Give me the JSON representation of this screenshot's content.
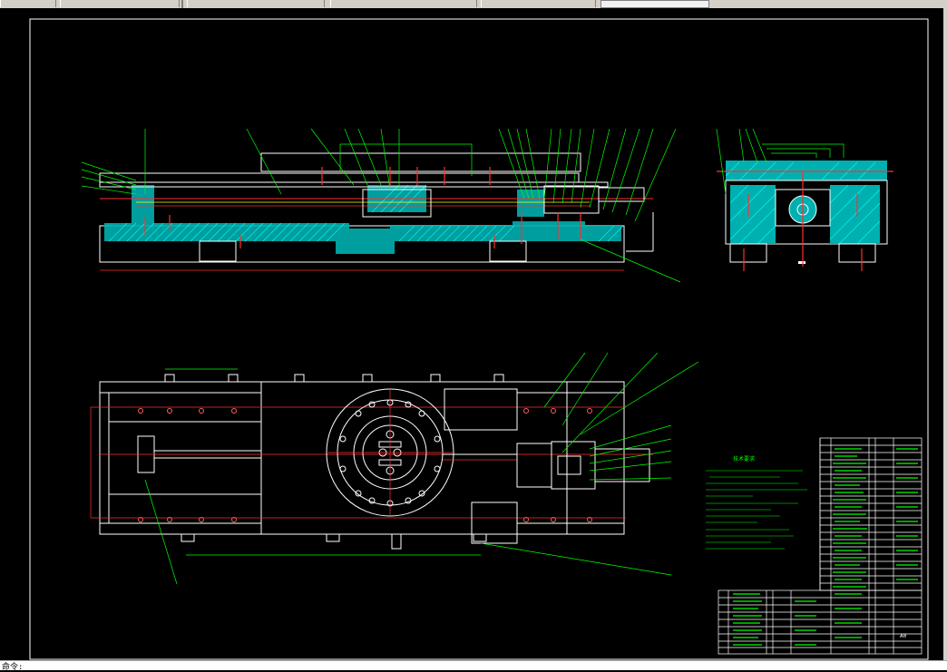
{
  "window": {
    "type": "cad-viewer"
  },
  "toolbar": {
    "tabs": [
      "",
      "",
      "",
      "",
      ""
    ]
  },
  "command_line": {
    "text": "命令:"
  },
  "drawing": {
    "notes_title": "技术要求",
    "title_block": {
      "drawing_name": "",
      "sheet": "A0"
    },
    "colors": {
      "background": "#000000",
      "frame": "#ffffff",
      "section": "#00ffff",
      "leader": "#00ff00",
      "centerline": "#ff0000",
      "dimension": "#ff4040",
      "part": "#ffffff"
    }
  }
}
